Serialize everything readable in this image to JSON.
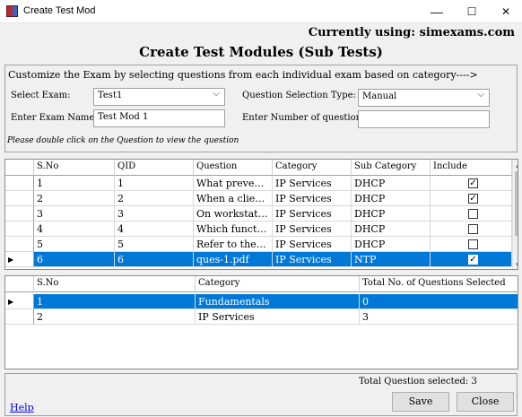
{
  "window": {
    "title": "Create Test Mod",
    "minimize": "—",
    "maximize": "☐",
    "close": "✕"
  },
  "header": {
    "using": "Currently using: simexams.com",
    "title": "Create Test Modules (Sub Tests)"
  },
  "form": {
    "heading": "Customize the Exam by selecting questions from each individual exam based on category---->",
    "select_exam_label": "Select Exam:",
    "select_exam_value": "Test1",
    "selection_type_label": "Question Selection Type:",
    "selection_type_value": "Manual",
    "exam_name_label": "Enter Exam Name:",
    "exam_name_value": "Test Mod 1",
    "num_questions_label": "Enter Number of questions",
    "num_questions_value": "",
    "hint": "Please double click on the Question to view the question"
  },
  "questions_grid": {
    "columns": [
      "S.No",
      "QID",
      "Question",
      "Category",
      "Sub Category",
      "Include"
    ],
    "rows": [
      {
        "sno": "1",
        "qid": "1",
        "question": "What prevents ...",
        "category": "IP Services",
        "subcategory": "DHCP",
        "include": true
      },
      {
        "sno": "2",
        "qid": "2",
        "question": "When a client a...",
        "category": "IP Services",
        "subcategory": "DHCP",
        "include": true
      },
      {
        "sno": "3",
        "qid": "3",
        "question": "On workstations...",
        "category": "IP Services",
        "subcategory": "DHCP",
        "include": false
      },
      {
        "sno": "4",
        "qid": "4",
        "question": "Which function i...",
        "category": "IP Services",
        "subcategory": "DHCP",
        "include": false
      },
      {
        "sno": "5",
        "qid": "5",
        "question": "Refer to the exhi...",
        "category": "IP Services",
        "subcategory": "DHCP",
        "include": false
      },
      {
        "sno": "6",
        "qid": "6",
        "question": "ques-1.pdf",
        "category": "IP Services",
        "subcategory": "NTP",
        "include": true
      }
    ],
    "selected_index": 5,
    "check_mark": "✓",
    "row_pointer": "▶"
  },
  "summary_grid": {
    "columns": [
      "S.No",
      "Category",
      "Total No. of Questions Selected"
    ],
    "rows": [
      {
        "sno": "1",
        "category": "Fundamentals",
        "total": "0"
      },
      {
        "sno": "2",
        "category": "IP Services",
        "total": "3"
      }
    ],
    "selected_index": 0
  },
  "footer": {
    "total_selected": "Total Question selected: 3",
    "save_label": "Save",
    "close_label": "Close",
    "help_label": "Help"
  },
  "colors": {
    "selection": "#0078d7",
    "link": "#0000ee"
  }
}
